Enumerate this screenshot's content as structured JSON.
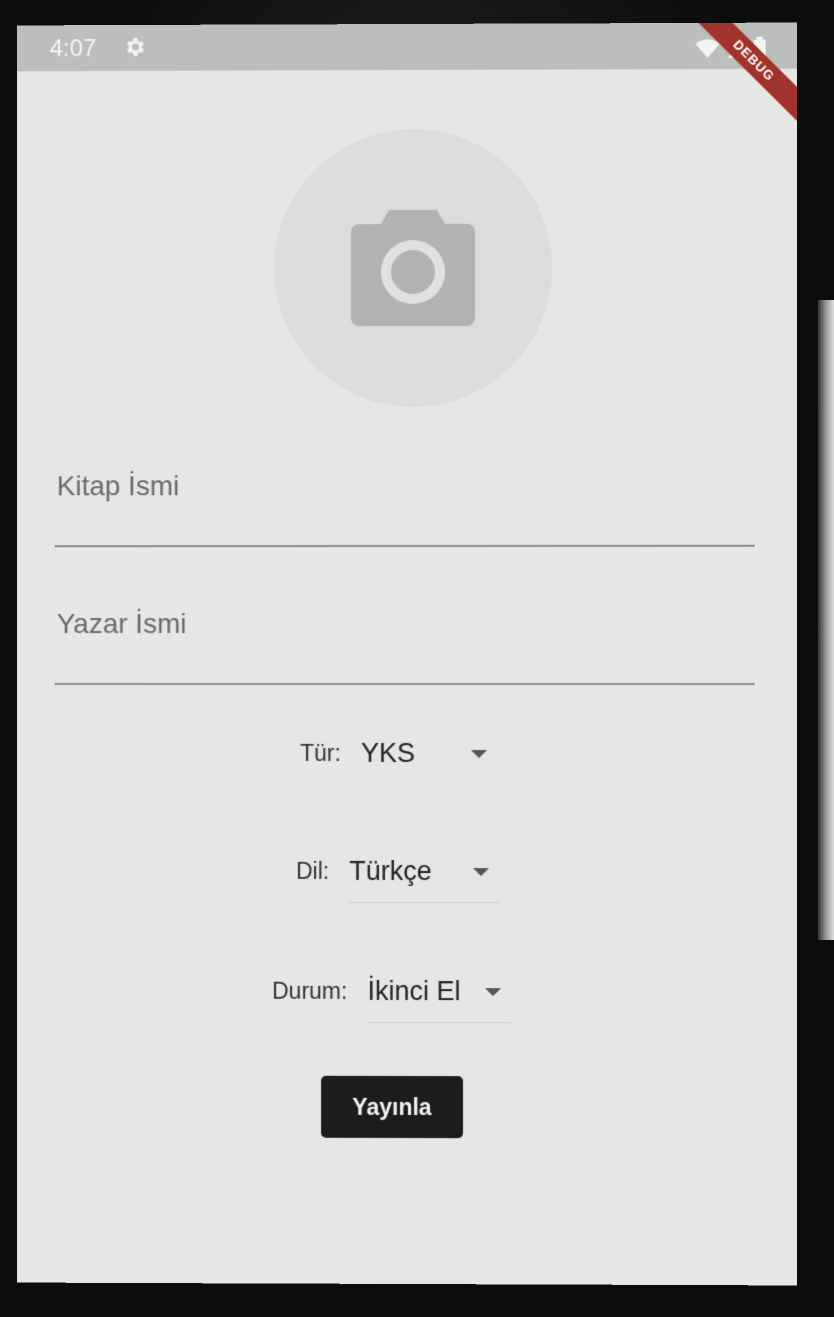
{
  "status_bar": {
    "time": "4:07",
    "debug_label": "DEBUG"
  },
  "form": {
    "book_name_label": "Kitap İsmi",
    "author_name_label": "Yazar İsmi",
    "genre": {
      "label": "Tür:",
      "value": "YKS"
    },
    "language": {
      "label": "Dil:",
      "value": "Türkçe"
    },
    "condition": {
      "label": "Durum:",
      "value": "İkinci El"
    },
    "publish_label": "Yayınla"
  },
  "icons": {
    "photo": "camera-icon",
    "settings": "gear-icon",
    "wifi": "wifi-icon",
    "signal": "signal-icon",
    "battery": "battery-icon",
    "dropdown": "caret-down-icon"
  }
}
